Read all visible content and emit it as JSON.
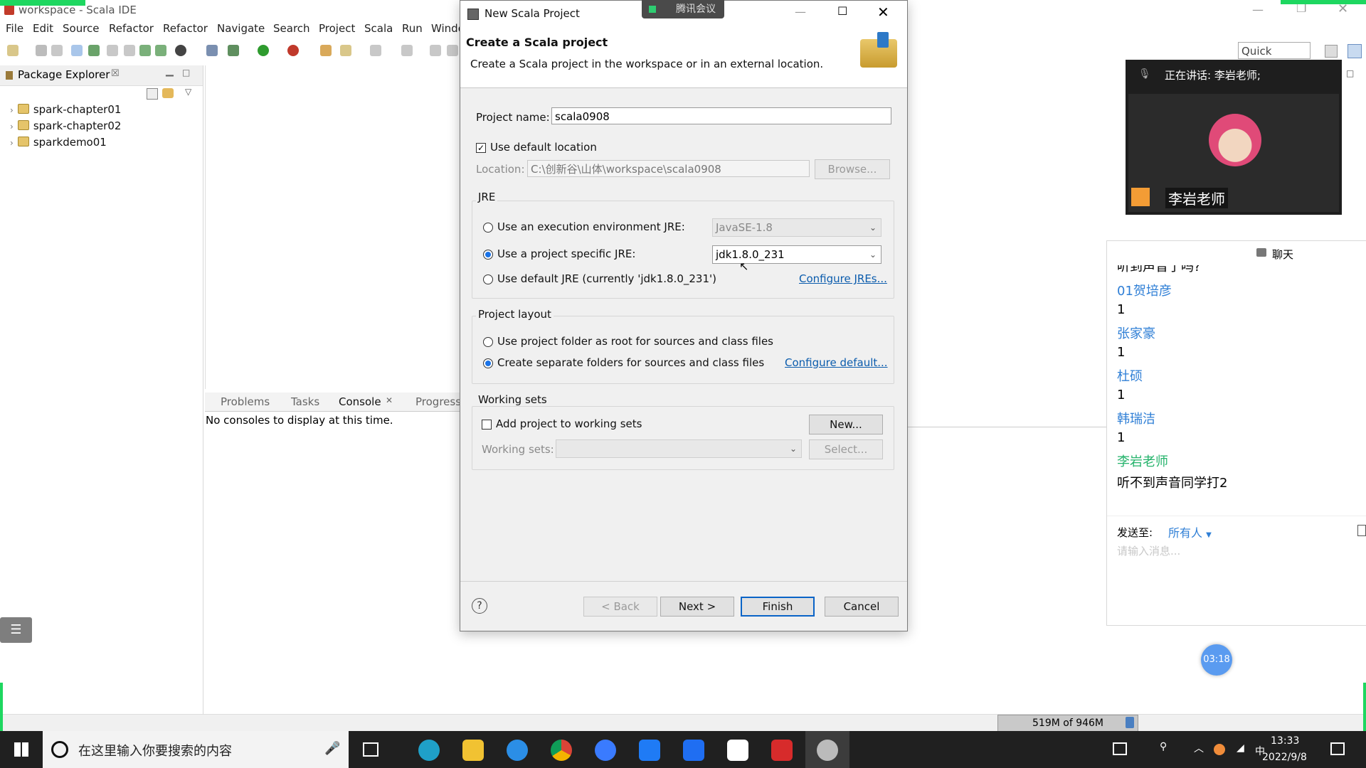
{
  "ide": {
    "title": "workspace - Scala IDE",
    "menu": [
      "File",
      "Edit",
      "Source",
      "Refactor",
      "Refactor",
      "Navigate",
      "Search",
      "Project",
      "Scala",
      "Run",
      "Windo"
    ],
    "quick_access": "Quick Access",
    "package_explorer": {
      "title": "Package Explorer",
      "items": [
        "spark-chapter01",
        "spark-chapter02",
        "sparkdemo01"
      ]
    },
    "console": {
      "tabs": [
        "Problems",
        "Tasks",
        "Console",
        "Progress"
      ],
      "message": "No consoles to display at this time."
    },
    "heap": "519M of 946M"
  },
  "dialog": {
    "title": "New Scala Project",
    "banner_title": "Create a Scala project",
    "banner_desc": "Create a Scala project in the workspace or in an external location.",
    "project_name_label": "Project name:",
    "project_name_value": "scala0908",
    "use_default_location": "Use default location",
    "location_label": "Location:",
    "location_value": "C:\\创新谷\\山体\\workspace\\scala0908",
    "browse": "Browse...",
    "jre_group": "JRE",
    "jre_option1": "Use an execution environment JRE:",
    "jre_option1_value": "JavaSE-1.8",
    "jre_option2": "Use a project specific JRE:",
    "jre_option2_value": "jdk1.8.0_231",
    "jre_option3": "Use default JRE (currently 'jdk1.8.0_231')",
    "configure_jres": "Configure JREs...",
    "layout_group": "Project layout",
    "layout_option1": "Use project folder as root for sources and class files",
    "layout_option2": "Create separate folders for sources and class files",
    "configure_default": "Configure default...",
    "working_sets_group": "Working sets",
    "add_to_working_sets": "Add project to working sets",
    "new_btn": "New...",
    "working_sets_label": "Working sets:",
    "select_btn": "Select...",
    "back": "< Back",
    "next": "Next >",
    "finish": "Finish",
    "cancel": "Cancel"
  },
  "meeting": {
    "app_name": "腾讯会议",
    "speaking": "正在讲话: 李岩老师;",
    "video_name": "李岩老师",
    "chat_title": "聊天",
    "chat_top_partial": "听到声音了吗?",
    "messages": [
      {
        "name": "01贺培彦",
        "text": "1"
      },
      {
        "name": "张家豪",
        "text": "1"
      },
      {
        "name": "杜硕",
        "text": "1"
      },
      {
        "name": "韩瑞洁",
        "text": "1"
      },
      {
        "name": "李岩老师",
        "text": "听不到声音同学打2"
      }
    ],
    "send_to_label": "发送至:",
    "send_to_value": "所有人",
    "input_placeholder": "请输入消息...",
    "timer": "03:18"
  },
  "taskbar": {
    "search_placeholder": "在这里输入你要搜索的内容",
    "time": "13:33",
    "date": "2022/9/8",
    "ime": "中"
  },
  "colors": {
    "accent_blue": "#0b5cad",
    "teacher_green": "#24b36b",
    "name_blue": "#2f7fd6",
    "taskbar": "#202020"
  }
}
